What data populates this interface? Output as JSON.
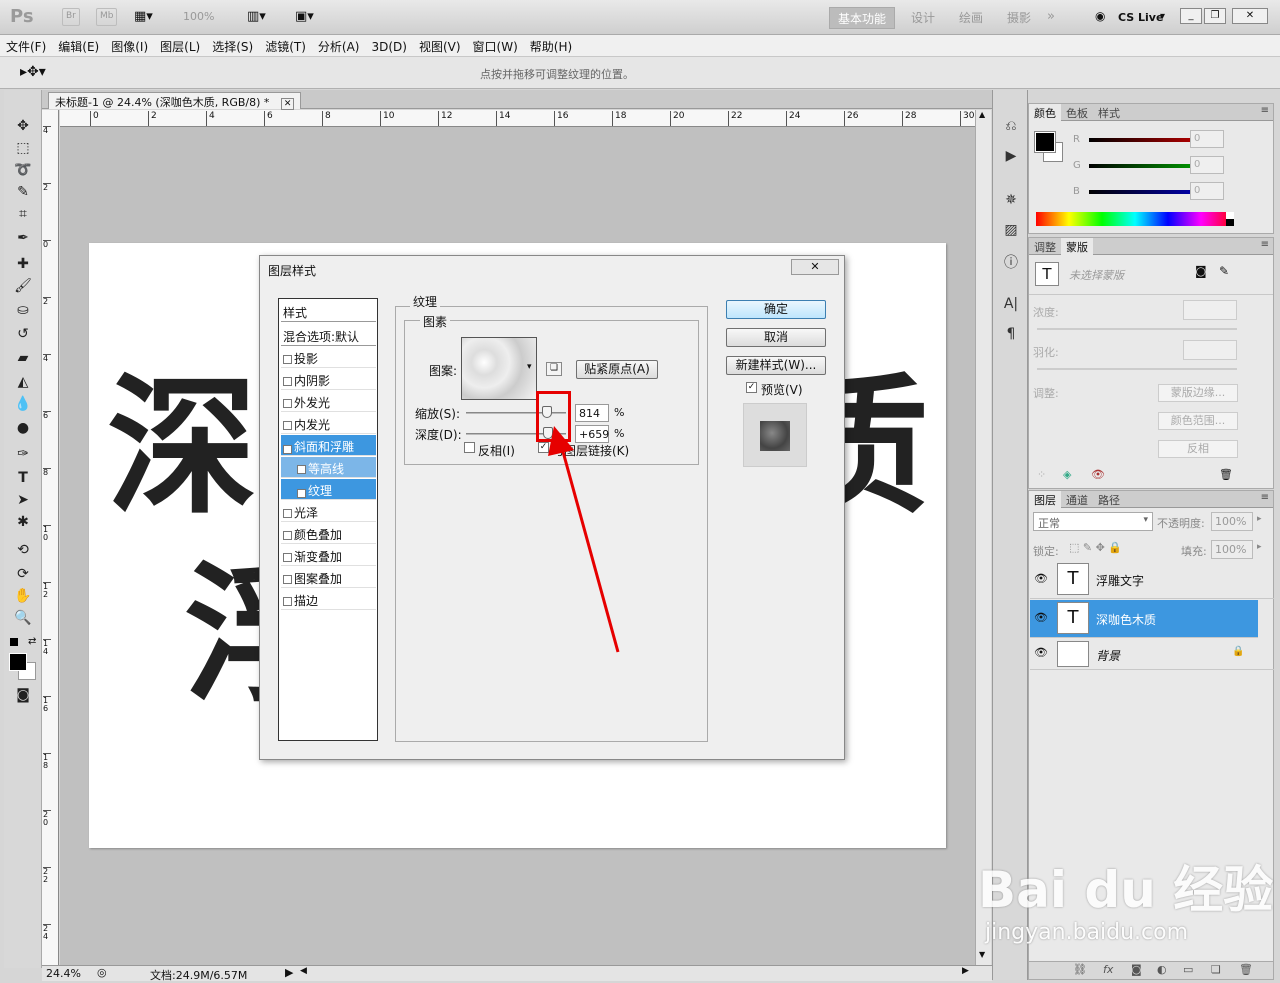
{
  "app": {
    "logo": "Ps",
    "bridge_btn": "Br",
    "minibridge_btn": "Mb",
    "zoom": "100%",
    "workspaces": [
      "基本功能",
      "设计",
      "绘画",
      "摄影"
    ],
    "cslive": "CS Live"
  },
  "menu": [
    "文件(F)",
    "编辑(E)",
    "图像(I)",
    "图层(L)",
    "选择(S)",
    "滤镜(T)",
    "分析(A)",
    "3D(D)",
    "视图(V)",
    "窗口(W)",
    "帮助(H)"
  ],
  "options": {
    "hint": "点按并拖移可调整纹理的位置。"
  },
  "document": {
    "tab_title": "未标题-1 @ 24.4% (深咖色木质, RGB/8) *",
    "zoom": "24.4%",
    "doc_size": "文档:24.9M/6.57M",
    "ruler_top": [
      "0",
      "2",
      "4",
      "6",
      "8",
      "10",
      "12",
      "14",
      "16",
      "18",
      "20",
      "22",
      "24",
      "26",
      "28",
      "30"
    ],
    "ruler_left": [
      "4",
      "2",
      "0",
      "2",
      "4",
      "6",
      "8",
      "1 0",
      "1 2",
      "1 4",
      "1 6",
      "1 8",
      "2 0",
      "2 2",
      "2 4"
    ],
    "canvas_chars": [
      "深",
      "质",
      "浮"
    ]
  },
  "dialog": {
    "title": "图层样式",
    "styles_header": "样式",
    "blend_options": "混合选项:默认",
    "items": [
      {
        "label": "投影",
        "checked": false
      },
      {
        "label": "内阴影",
        "checked": false
      },
      {
        "label": "外发光",
        "checked": false
      },
      {
        "label": "内发光",
        "checked": false
      },
      {
        "label": "斜面和浮雕",
        "checked": true
      },
      {
        "label": "等高线",
        "checked": false
      },
      {
        "label": "纹理",
        "checked": true
      },
      {
        "label": "光泽",
        "checked": false
      },
      {
        "label": "颜色叠加",
        "checked": false
      },
      {
        "label": "渐变叠加",
        "checked": false
      },
      {
        "label": "图案叠加",
        "checked": false
      },
      {
        "label": "描边",
        "checked": false
      }
    ],
    "group_title": "纹理",
    "subgroup_title": "图素",
    "pattern_label": "图案:",
    "snap_button": "贴紧原点(A)",
    "scale_label": "缩放(S):",
    "scale_value": "814",
    "scale_unit": "%",
    "scale_fraction": 0.81,
    "depth_label": "深度(D):",
    "depth_value": "+659",
    "depth_unit": "%",
    "depth_fraction": 0.82,
    "invert_label": "反相(I)",
    "link_label": "与图层链接(K)",
    "ok": "确定",
    "cancel": "取消",
    "new_style": "新建样式(W)...",
    "preview": "预览(V)"
  },
  "color_panel": {
    "tabs": [
      "颜色",
      "色板",
      "样式"
    ],
    "channels": [
      {
        "label": "R",
        "value": "0",
        "color": "#d00000"
      },
      {
        "label": "G",
        "value": "0",
        "color": "#00b000"
      },
      {
        "label": "B",
        "value": "0",
        "color": "#0000c8"
      }
    ]
  },
  "mask_panel": {
    "tabs": [
      "调整",
      "蒙版"
    ],
    "no_mask": "未选择蒙版",
    "density": "浓度:",
    "feather": "羽化:",
    "adjust": "调整:",
    "buttons": [
      "蒙版边缘...",
      "颜色范围...",
      "反相"
    ]
  },
  "layers_panel": {
    "tabs": [
      "图层",
      "通道",
      "路径"
    ],
    "blend_mode": "正常",
    "opacity_label": "不透明度:",
    "opacity": "100%",
    "lock_label": "锁定:",
    "fill_label": "填充:",
    "fill": "100%",
    "layers": [
      {
        "name": "浮雕文字",
        "thumb": "T"
      },
      {
        "name": "深咖色木质",
        "thumb": "T"
      },
      {
        "name": "背景",
        "thumb": ""
      }
    ]
  },
  "watermark": {
    "brand": "Bai du 经验",
    "url": "jingyan.baidu.com"
  }
}
